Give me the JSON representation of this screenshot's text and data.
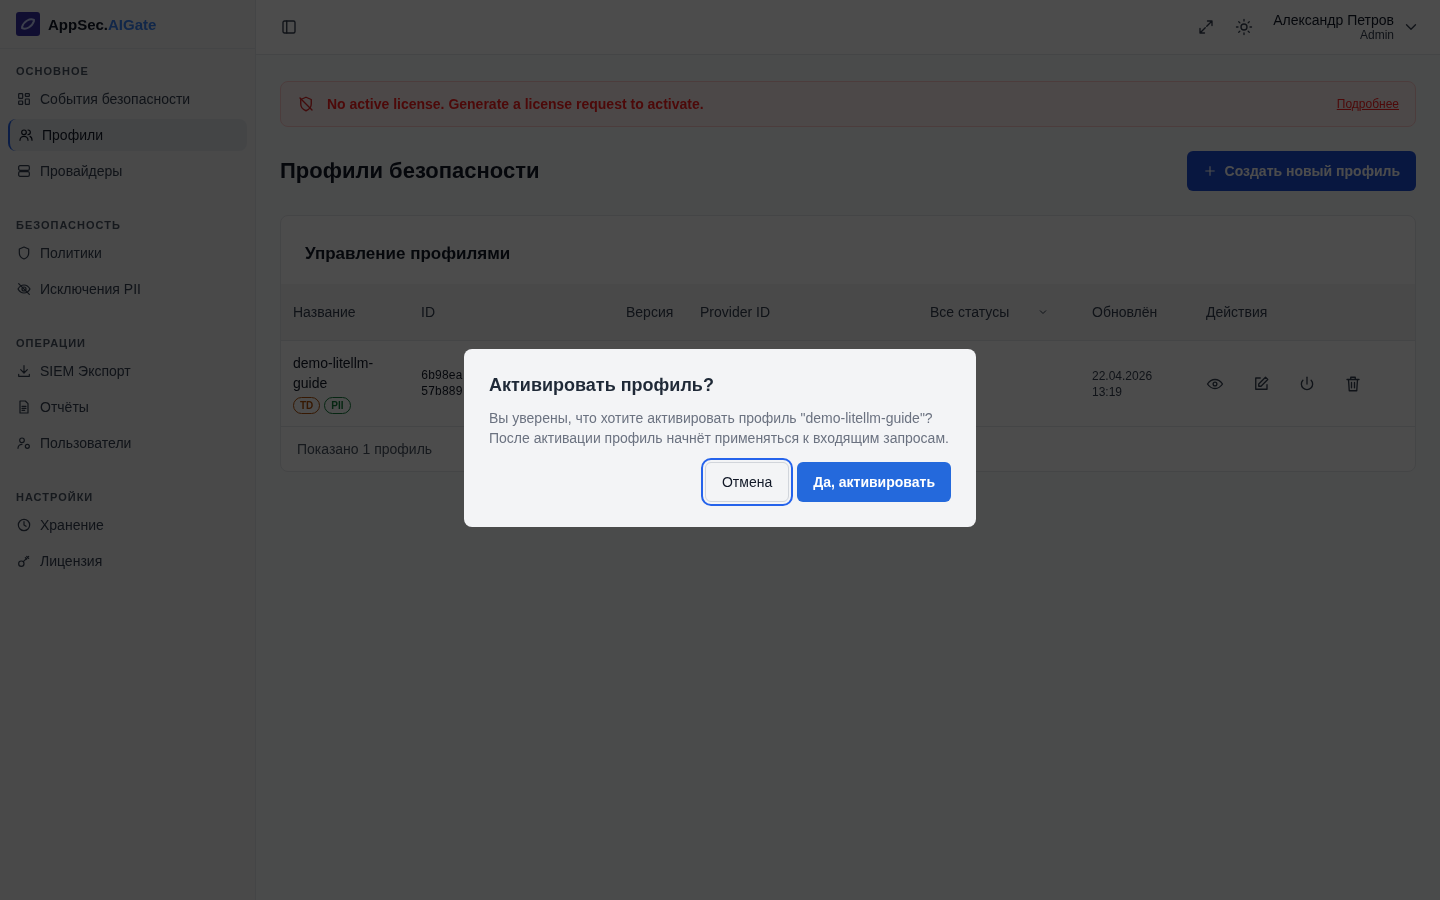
{
  "brand": {
    "name": "AppSec.",
    "accent": "AIGate"
  },
  "sidebar": {
    "sections": [
      {
        "title": "ОСНОВНОЕ",
        "items": [
          {
            "label": "События безопасности",
            "selected": false
          },
          {
            "label": "Профили",
            "selected": true
          },
          {
            "label": "Провайдеры",
            "selected": false
          }
        ]
      },
      {
        "title": "БЕЗОПАСНОСТЬ",
        "items": [
          {
            "label": "Политики",
            "selected": false
          },
          {
            "label": "Исключения PII",
            "selected": false
          }
        ]
      },
      {
        "title": "ОПЕРАЦИИ",
        "items": [
          {
            "label": "SIEM Экспорт",
            "selected": false
          },
          {
            "label": "Отчёты",
            "selected": false
          },
          {
            "label": "Пользователи",
            "selected": false
          }
        ]
      },
      {
        "title": "НАСТРОЙКИ",
        "items": [
          {
            "label": "Хранение",
            "selected": false
          },
          {
            "label": "Лицензия",
            "selected": false
          }
        ]
      }
    ]
  },
  "user": {
    "name": "Александр Петров",
    "role": "Admin"
  },
  "alert": {
    "message": "No active license. Generate a license request to activate.",
    "link": "Подробнее"
  },
  "page_title": "Профили безопасности",
  "create_button": "Создать новый профиль",
  "card": {
    "title": "Управление профилями",
    "columns": [
      "Название",
      "ID",
      "Версия",
      "Provider ID",
      "Все статусы",
      "Обновлён",
      "Действия"
    ],
    "rows": [
      {
        "name": "demo-litellm-guide",
        "tags": [
          "TD",
          "PII"
        ],
        "id_lines": [
          "6b98ea",
          "57b889"
        ],
        "updated_lines": [
          "22.04.2026",
          "13:19"
        ]
      }
    ],
    "footer": "Показано 1 профиль"
  },
  "dialog": {
    "title": "Активировать профиль?",
    "message": "Вы уверены, что хотите активировать профиль \"demo-litellm-guide\"? После активации профиль начнёт применяться к входящим запросам.",
    "cancel": "Отмена",
    "confirm": "Да, активировать"
  }
}
